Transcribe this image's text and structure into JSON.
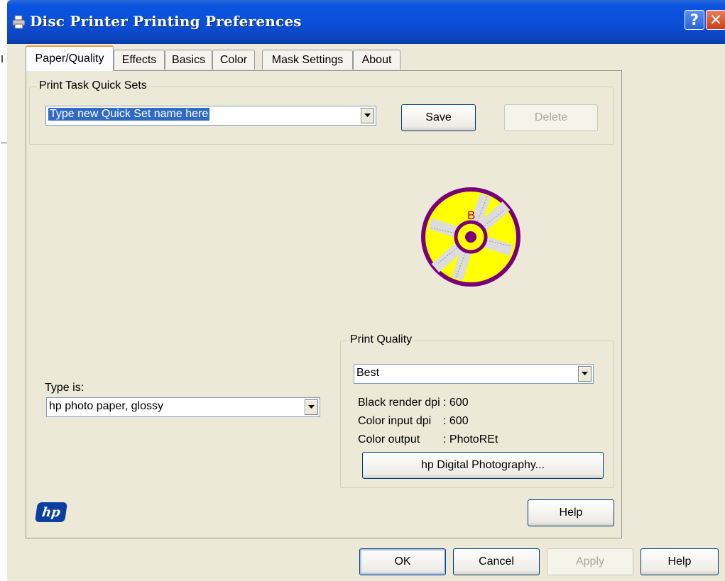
{
  "window": {
    "title": "Disc Printer Printing Preferences",
    "help_button": "?",
    "close_button": "✕"
  },
  "tabs": [
    {
      "label": "Paper/Quality"
    },
    {
      "label": "Effects"
    },
    {
      "label": "Basics"
    },
    {
      "label": "Color"
    },
    {
      "label": "Mask Settings"
    },
    {
      "label": "About"
    }
  ],
  "quick_sets": {
    "legend": "Print Task Quick Sets",
    "value": "Type new Quick Set name here",
    "save_label": "Save",
    "delete_label": "Delete"
  },
  "disc_preview": {
    "letter": "B"
  },
  "paper_type": {
    "label": "Type is:",
    "value": "hp photo paper, glossy"
  },
  "print_quality": {
    "legend": "Print Quality",
    "value": "Best",
    "info": [
      {
        "key": "Black render dpi",
        "value": ": 600"
      },
      {
        "key": "Color input dpi",
        "value": ": 600"
      },
      {
        "key": "Color output",
        "value": ": PhotoREt"
      }
    ],
    "photo_button": "hp Digital Photography..."
  },
  "panel_help": "Help",
  "footer": {
    "ok": "OK",
    "cancel": "Cancel",
    "apply": "Apply",
    "help": "Help"
  },
  "colors": {
    "titlebar": "#0a4fd8",
    "disc_fill": "#ffff00",
    "disc_ring": "#800080",
    "hp_blue": "#0a3fa0"
  }
}
